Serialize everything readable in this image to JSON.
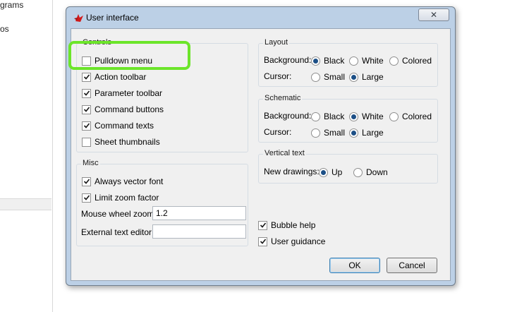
{
  "background": {
    "fragments": [
      "grams",
      "os"
    ]
  },
  "dialog": {
    "title": "User interface",
    "icon": "red-app-icon",
    "close_glyph": "✕"
  },
  "controls": {
    "title": "Controls",
    "items": [
      {
        "label": "Pulldown menu",
        "checked": false
      },
      {
        "label": "Action toolbar",
        "checked": true
      },
      {
        "label": "Parameter toolbar",
        "checked": true
      },
      {
        "label": "Command buttons",
        "checked": true
      },
      {
        "label": "Command texts",
        "checked": true
      },
      {
        "label": "Sheet thumbnails",
        "checked": false
      }
    ]
  },
  "misc": {
    "title": "Misc",
    "always_vector_font": {
      "label": "Always vector font",
      "checked": true
    },
    "limit_zoom_factor": {
      "label": "Limit zoom factor",
      "checked": true
    },
    "mouse_wheel_zoom": {
      "label": "Mouse wheel zoom",
      "value": "1.2"
    },
    "external_text_editor": {
      "label": "External text editor",
      "value": ""
    }
  },
  "layout": {
    "title": "Layout",
    "background_label": "Background:",
    "background_options": [
      "Black",
      "White",
      "Colored"
    ],
    "background_selected": "Black",
    "cursor_label": "Cursor:",
    "cursor_options": [
      "Small",
      "Large"
    ],
    "cursor_selected": "Large"
  },
  "schematic": {
    "title": "Schematic",
    "background_label": "Background:",
    "background_options": [
      "Black",
      "White",
      "Colored"
    ],
    "background_selected": "White",
    "cursor_label": "Cursor:",
    "cursor_options": [
      "Small",
      "Large"
    ],
    "cursor_selected": "Large"
  },
  "vertical_text": {
    "title": "Vertical text",
    "new_drawings_label": "New drawings:",
    "options": [
      "Up",
      "Down"
    ],
    "selected": "Up"
  },
  "bubble_help": {
    "label": "Bubble help",
    "checked": true
  },
  "user_guidance": {
    "label": "User guidance",
    "checked": true
  },
  "buttons": {
    "ok": "OK",
    "cancel": "Cancel"
  },
  "colors": {
    "highlight": "#6ce52a",
    "radio_dot": "#1c4f86",
    "dialog_frame": "#bcd0e6",
    "client_bg": "#f0f0f0"
  }
}
